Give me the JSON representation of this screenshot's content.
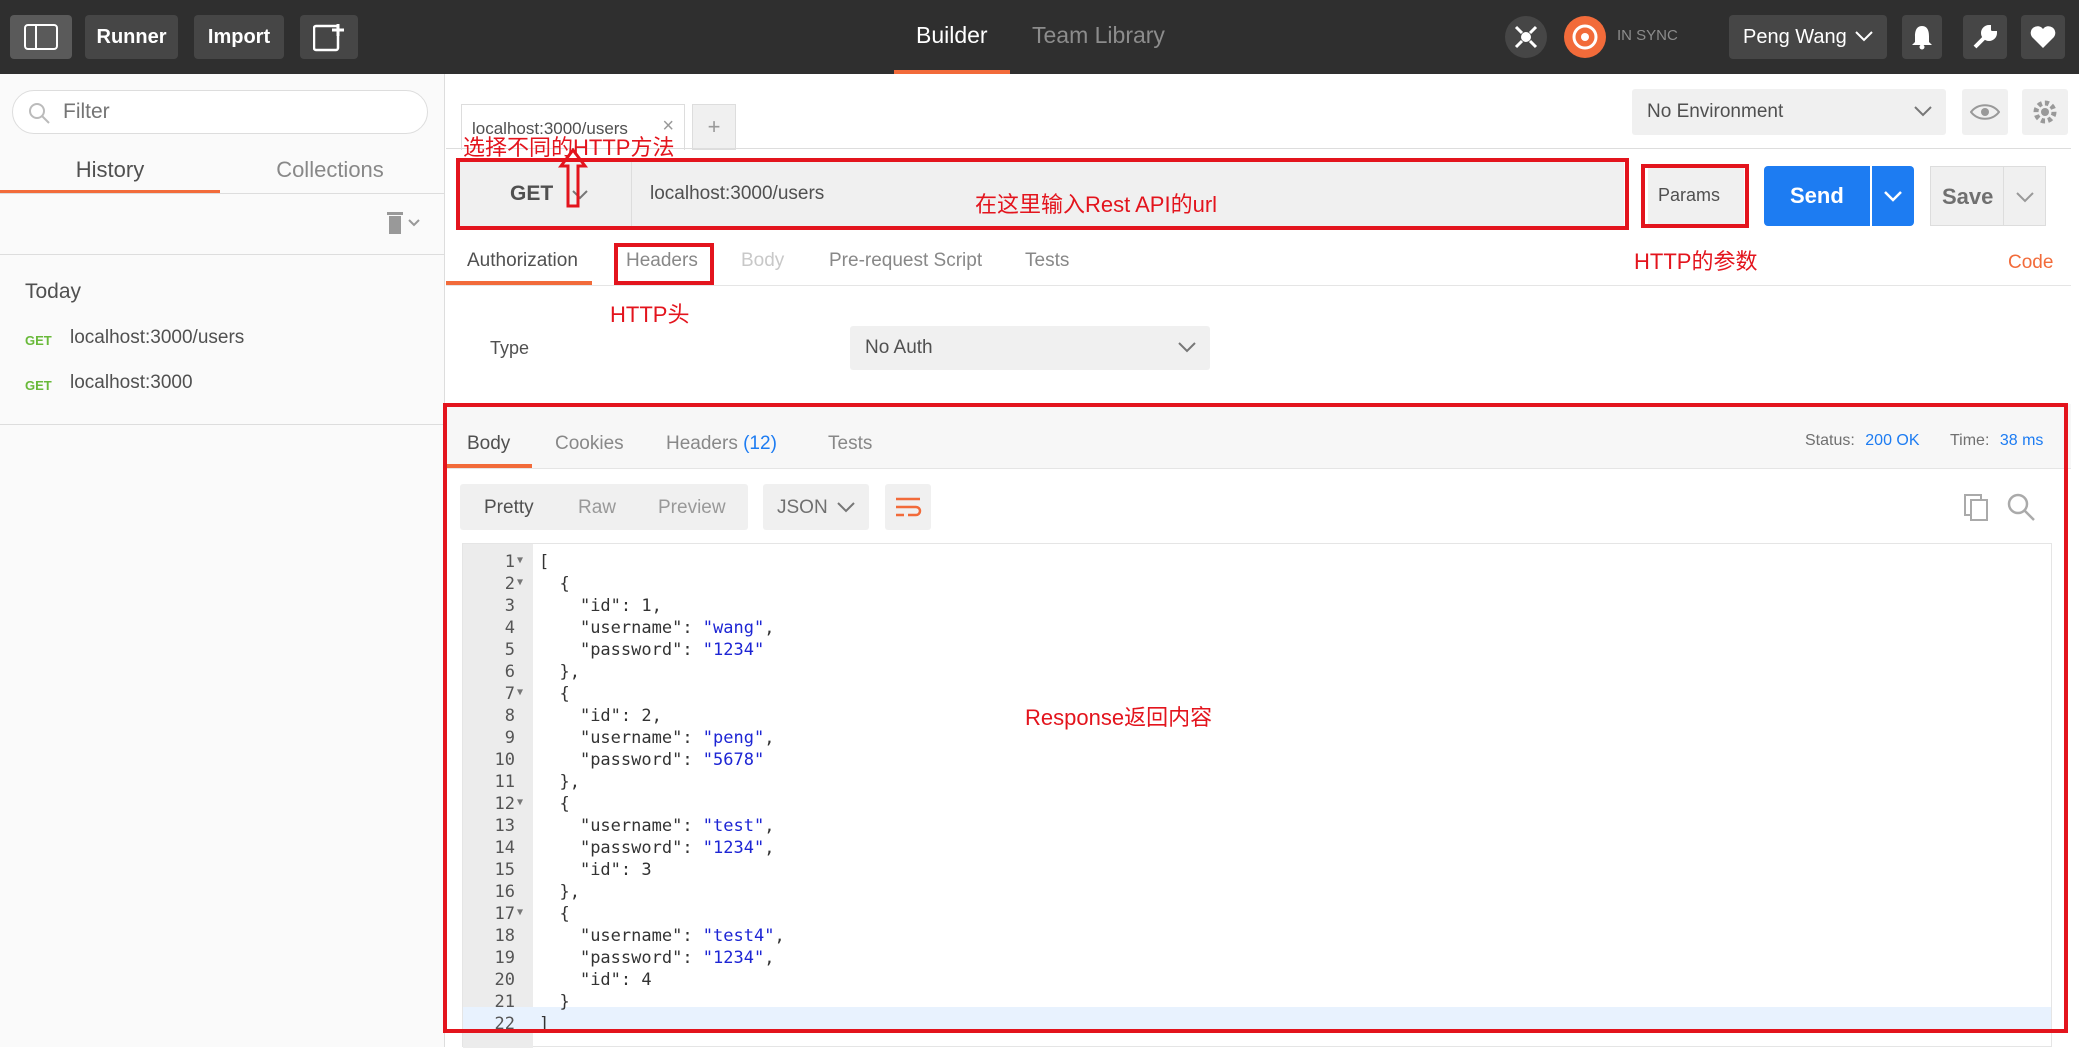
{
  "topbar": {
    "runner": "Runner",
    "import": "Import",
    "tab_builder": "Builder",
    "tab_team_library": "Team Library",
    "sync_status": "IN SYNC",
    "user": "Peng Wang"
  },
  "sidebar": {
    "filter_placeholder": "Filter",
    "tabs": [
      "History",
      "Collections"
    ],
    "section": "Today",
    "items": [
      {
        "method": "GET",
        "url": "localhost:3000/users"
      },
      {
        "method": "GET",
        "url": "localhost:3000"
      }
    ]
  },
  "request": {
    "tab_label": "localhost:3000/users",
    "add_tab": "+",
    "environment": "No Environment",
    "method": "GET",
    "url": "localhost:3000/users",
    "params": "Params",
    "send": "Send",
    "save": "Save",
    "tabs": [
      "Authorization",
      "Headers",
      "Body",
      "Pre-request Script",
      "Tests"
    ],
    "code_link": "Code",
    "auth_type_label": "Type",
    "auth_type_value": "No Auth"
  },
  "annotations": {
    "method": "选择不同的HTTP方法",
    "url": "在这里输入Rest API的url",
    "params": "HTTP的参数",
    "headers": "HTTP头",
    "response": "Response返回内容"
  },
  "response": {
    "tabs": [
      "Body",
      "Cookies",
      "Headers",
      "Tests"
    ],
    "headers_count": "(12)",
    "status_label": "Status:",
    "status_value": "200 OK",
    "time_label": "Time:",
    "time_value": "38 ms",
    "view_modes": [
      "Pretty",
      "Raw",
      "Preview"
    ],
    "format": "JSON",
    "lines": [
      "[",
      "  {",
      "    \"id\": 1,",
      "    \"username\": \"wang\",",
      "    \"password\": \"1234\"",
      "  },",
      "  {",
      "    \"id\": 2,",
      "    \"username\": \"peng\",",
      "    \"password\": \"5678\"",
      "  },",
      "  {",
      "    \"username\": \"test\",",
      "    \"password\": \"1234\",",
      "    \"id\": 3",
      "  },",
      "  {",
      "    \"username\": \"test4\",",
      "    \"password\": \"1234\",",
      "    \"id\": 4",
      "  }",
      "]"
    ],
    "fold_lines": [
      1,
      2,
      7,
      12,
      17
    ]
  },
  "colors": {
    "accent": "#f26b3a",
    "primary": "#1d7cf2",
    "annotation": "#e3141d",
    "get_method": "#69b93a"
  }
}
